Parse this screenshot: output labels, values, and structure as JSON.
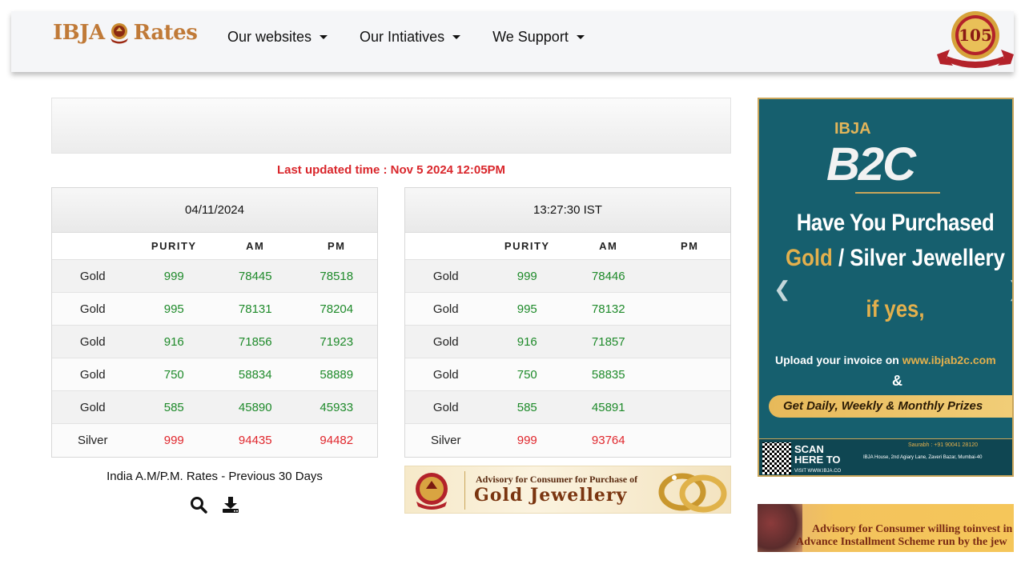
{
  "header": {
    "logo_left": "IBJA",
    "logo_right": "Rates",
    "nav": [
      {
        "label": "Our websites"
      },
      {
        "label": "Our Intiatives"
      },
      {
        "label": "We Support"
      }
    ],
    "badge_number": "105"
  },
  "updated": "Last updated time : Nov 5 2024 12:05PM",
  "left_table": {
    "title": "04/11/2024",
    "columns": [
      "",
      "PURITY",
      "AM",
      "PM"
    ],
    "rows": [
      {
        "metal": "Gold",
        "purity": "999",
        "am": "78445",
        "pm": "78518",
        "tone": "g"
      },
      {
        "metal": "Gold",
        "purity": "995",
        "am": "78131",
        "pm": "78204",
        "tone": "g"
      },
      {
        "metal": "Gold",
        "purity": "916",
        "am": "71856",
        "pm": "71923",
        "tone": "g"
      },
      {
        "metal": "Gold",
        "purity": "750",
        "am": "58834",
        "pm": "58889",
        "tone": "g"
      },
      {
        "metal": "Gold",
        "purity": "585",
        "am": "45890",
        "pm": "45933",
        "tone": "g"
      },
      {
        "metal": "Silver",
        "purity": "999",
        "am": "94435",
        "pm": "94482",
        "tone": "r"
      }
    ]
  },
  "right_table": {
    "title": "13:27:30 IST",
    "columns": [
      "",
      "PURITY",
      "AM",
      "PM"
    ],
    "rows": [
      {
        "metal": "Gold",
        "purity": "999",
        "am": "78446",
        "pm": "",
        "tone": "g"
      },
      {
        "metal": "Gold",
        "purity": "995",
        "am": "78132",
        "pm": "",
        "tone": "g"
      },
      {
        "metal": "Gold",
        "purity": "916",
        "am": "71857",
        "pm": "",
        "tone": "g"
      },
      {
        "metal": "Gold",
        "purity": "750",
        "am": "58835",
        "pm": "",
        "tone": "g"
      },
      {
        "metal": "Gold",
        "purity": "585",
        "am": "45891",
        "pm": "",
        "tone": "g"
      },
      {
        "metal": "Silver",
        "purity": "999",
        "am": "93764",
        "pm": "",
        "tone": "r"
      }
    ]
  },
  "previous": {
    "label": "India A.M/P.M. Rates - Previous 30 Days",
    "icons": [
      "search-icon",
      "download-icon"
    ]
  },
  "advisory": {
    "line1": "Advisory for Consumer for Purchase of",
    "line2": "Gold Jewellery"
  },
  "ad": {
    "brand_top": "IBJA",
    "brand": "B2C",
    "headline1": "Have You Purchased",
    "headline2_gold": "Gold",
    "headline2_rest": " / Silver Jewellery",
    "ifyes": "if yes,",
    "upload_prefix": "Upload your invoice on ",
    "upload_url": "www.ibjab2c.com",
    "amp": "&",
    "prizes": "Get Daily, Weekly & Monthly Prizes",
    "scan1": "SCAN",
    "scan2": "HERE TO",
    "scan3": "VISIT WWW.IBJA.CO",
    "phone": "Saurabh : +91 90041 28120",
    "address": "IBJA House, 2nd Agiary Lane, Zaveri Bazar, Mumbai-40"
  },
  "ad2": {
    "line1": "Advisory for Consumer willing toinvest in",
    "line2": "Advance Installment Scheme run by the jew"
  },
  "colors": {
    "green": "#1e8a2a",
    "red": "#e0262c",
    "updated_red": "#d9262b",
    "brand_gold": "#c07a38",
    "ad_teal": "#165f6e"
  }
}
